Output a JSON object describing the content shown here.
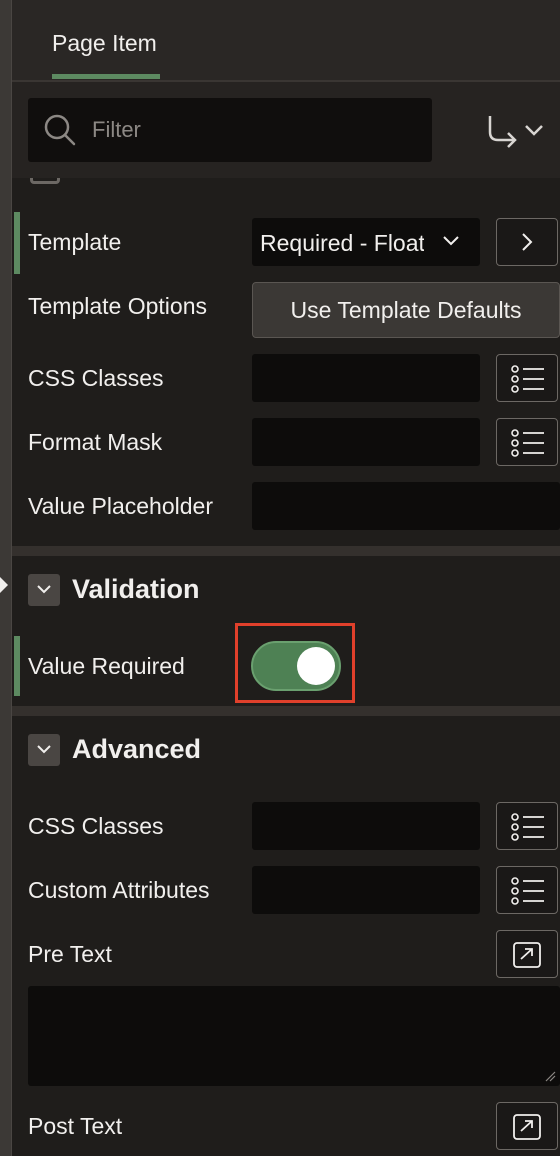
{
  "tab": {
    "label": "Page Item"
  },
  "filter": {
    "placeholder": "Filter"
  },
  "appearance": {
    "template": {
      "label": "Template",
      "value": "Required - Floating"
    },
    "template_options": {
      "label": "Template Options",
      "button": "Use Template Defaults"
    },
    "css_classes": {
      "label": "CSS Classes"
    },
    "format_mask": {
      "label": "Format Mask"
    },
    "value_placeholder": {
      "label": "Value Placeholder"
    }
  },
  "validation": {
    "title": "Validation",
    "value_required": {
      "label": "Value Required",
      "on": true
    }
  },
  "advanced": {
    "title": "Advanced",
    "css_classes": {
      "label": "CSS Classes"
    },
    "custom_attributes": {
      "label": "Custom Attributes"
    },
    "pre_text": {
      "label": "Pre Text"
    },
    "post_text": {
      "label": "Post Text"
    }
  },
  "colors": {
    "accent_green": "#5d8a61",
    "switch_on": "#4e8154",
    "highlight": "#e0402b"
  }
}
